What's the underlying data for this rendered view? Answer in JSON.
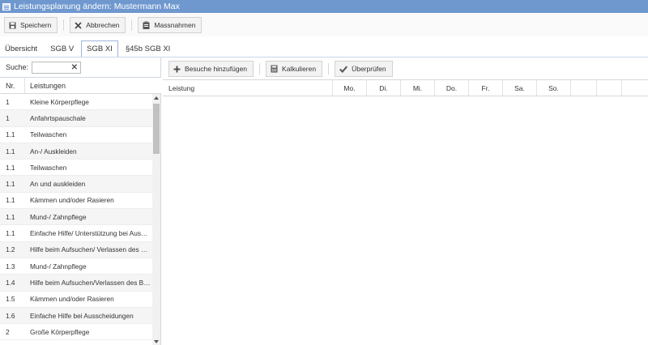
{
  "window": {
    "title": "Leistungsplanung ändern: Mustermann Max",
    "icon": "window-icon"
  },
  "toolbar": {
    "save_label": "Speichern",
    "cancel_label": "Abbrechen",
    "measures_label": "Massnahmen"
  },
  "tabs": [
    {
      "label": "Übersicht",
      "active": false
    },
    {
      "label": "SGB V",
      "active": false
    },
    {
      "label": "SGB XI",
      "active": true
    },
    {
      "label": "§45b SGB XI",
      "active": false
    }
  ],
  "search": {
    "label": "Suche:",
    "value": "",
    "placeholder": ""
  },
  "left_grid": {
    "headers": [
      "Nr.",
      "Leistungen"
    ],
    "rows": [
      {
        "nr": "1",
        "name": "Kleine Körperpflege"
      },
      {
        "nr": "1",
        "name": "Anfahrtspauschale"
      },
      {
        "nr": "1.1",
        "name": "Teilwaschen"
      },
      {
        "nr": "1.1",
        "name": "An-/ Auskleiden"
      },
      {
        "nr": "1.1",
        "name": "Teilwaschen"
      },
      {
        "nr": "1.1",
        "name": "An und auskleiden"
      },
      {
        "nr": "1.1",
        "name": "Kämmen und/oder Rasieren"
      },
      {
        "nr": "1.1",
        "name": "Mund-/ Zahnpflege"
      },
      {
        "nr": "1.1",
        "name": "Einfache Hilfe/ Unterstützung bei Ausscheidungen"
      },
      {
        "nr": "1.2",
        "name": "Hilfe beim Aufsuchen/ Verlassen des Bettes"
      },
      {
        "nr": "1.3",
        "name": "Mund-/ Zahnpflege"
      },
      {
        "nr": "1.4",
        "name": "Hilfe beim Aufsuchen/Verlassen des Bettes"
      },
      {
        "nr": "1.5",
        "name": "Kämmen und/oder Rasieren"
      },
      {
        "nr": "1.6",
        "name": "Einfache Hilfe bei Ausscheidungen"
      },
      {
        "nr": "2",
        "name": "Große Körperpflege"
      }
    ]
  },
  "right_toolbar": {
    "add_visits_label": "Besuche hinzufügen",
    "calculate_label": "Kalkulieren",
    "check_label": "Überprüfen"
  },
  "right_grid": {
    "headers": [
      "Leistung",
      "Mo.",
      "Di.",
      "Mi.",
      "Do.",
      "Fr.",
      "Sa.",
      "So.",
      "",
      ""
    ]
  },
  "colors": {
    "titlebar": "#6f98cf",
    "tab_border": "#9bb6d8",
    "row_alt": "#f5f5f5"
  }
}
